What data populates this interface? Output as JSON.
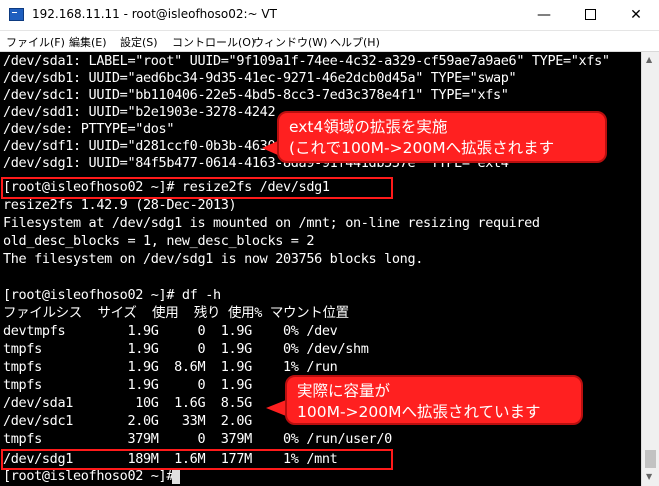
{
  "window": {
    "title": "192.168.11.11 - root@isleofhoso02:~ VT"
  },
  "menubar": {
    "items": [
      "ファイル(F)",
      "編集(E)",
      "設定(S)",
      "コントロール(O)",
      "ウィンドウ(W)",
      "ヘルプ(H)"
    ]
  },
  "terminal": {
    "lines": [
      "/dev/sda1: LABEL=\"root\" UUID=\"9f109a1f-74ee-4c32-a329-cf59ae7a9ae6\" TYPE=\"xfs\"",
      "/dev/sdb1: UUID=\"aed6bc34-9d35-41ec-9271-46e2dcb0d45a\" TYPE=\"swap\"",
      "/dev/sdc1: UUID=\"bb110406-22e5-4bd5-8cc3-7ed3c378e4f1\" TYPE=\"xfs\"",
      "/dev/sdd1: UUID=\"b2e1903e-3278-4242",
      "/dev/sde: PTTYPE=\"dos\"",
      "/dev/sdf1: UUID=\"d281ccf0-0b3b-4630",
      "/dev/sdg1: UUID=\"84f5b477-0614-4163-8da9-91f441db557e\" TYPE=\"ext4\"",
      "[root@isleofhoso02 ~]# resize2fs /dev/sdg1",
      "resize2fs 1.42.9 (28-Dec-2013)",
      "Filesystem at /dev/sdg1 is mounted on /mnt; on-line resizing required",
      "old_desc_blocks = 1, new_desc_blocks = 2",
      "The filesystem on /dev/sdg1 is now 203756 blocks long.",
      "",
      "[root@isleofhoso02 ~]# df -h",
      "ファイルシス  サイズ  使用  残り 使用% マウント位置",
      "devtmpfs        1.9G     0  1.9G    0% /dev",
      "tmpfs           1.9G     0  1.9G    0% /dev/shm",
      "tmpfs           1.9G  8.6M  1.9G    1% /run",
      "tmpfs           1.9G     0  1.9G",
      "/dev/sda1        10G  1.6G  8.5G",
      "/dev/sdc1       2.0G   33M  2.0G",
      "tmpfs           379M     0  379M    0% /run/user/0",
      "/dev/sdg1       189M  1.6M  177M    1% /mnt",
      "[root@isleofhoso02 ~]# "
    ]
  },
  "annotations": {
    "callout1": {
      "line1": "ext4領域の拡張を実施",
      "line2": "(これで100M->200Mへ拡張されます"
    },
    "callout2": {
      "line1": "実際に容量が",
      "line2": "100M->200Mへ拡張されています"
    }
  },
  "colors": {
    "callout": "#ff2020",
    "highlight_box": "#ff1a1a",
    "terminal_bg": "#000000",
    "terminal_fg": "#ffffff"
  }
}
